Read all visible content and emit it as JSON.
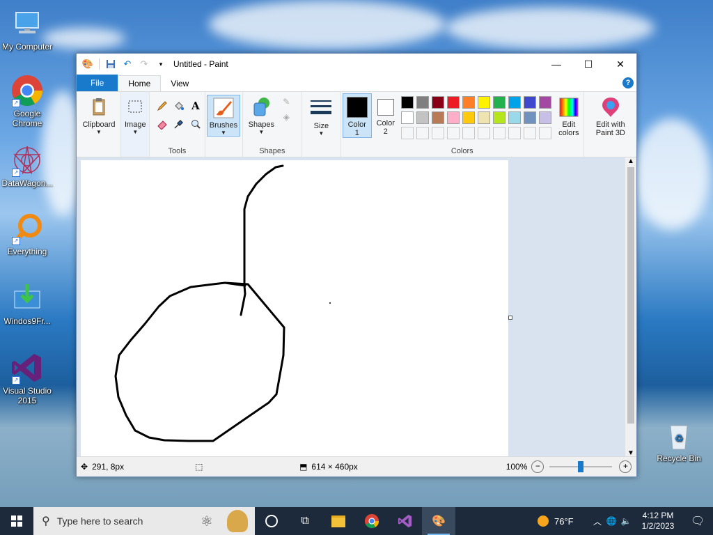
{
  "desktop": {
    "icons": [
      {
        "label": "My Computer"
      },
      {
        "label": "Google Chrome"
      },
      {
        "label": "DataWagon..."
      },
      {
        "label": "Everything"
      },
      {
        "label": "Windos9Fr..."
      },
      {
        "label": "Visual Studio 2015"
      },
      {
        "label": "Recycle Bin"
      }
    ]
  },
  "window": {
    "title": "Untitled - Paint",
    "tabs": [
      "File",
      "Home",
      "View"
    ],
    "help": "?"
  },
  "ribbon": {
    "clipboard": "Clipboard",
    "image": "Image",
    "tools": "Tools",
    "brushes": "Brushes",
    "shapes_btn": "Shapes",
    "shapes_group": "Shapes",
    "size": "Size",
    "color1": "Color\n1",
    "color1_a": "Color",
    "color1_b": "1",
    "color2_a": "Color",
    "color2_b": "2",
    "colors_group": "Colors",
    "edit_colors_a": "Edit",
    "edit_colors_b": "colors",
    "edit_paint3d_a": "Edit with",
    "edit_paint3d_b": "Paint 3D",
    "text_tool": "A",
    "palette_row1": [
      "#000000",
      "#7f7f7f",
      "#880015",
      "#ed1c24",
      "#ff7f27",
      "#fff200",
      "#22b14c",
      "#00a2e8",
      "#3f48cc",
      "#a349a4"
    ],
    "palette_row2": [
      "#ffffff",
      "#c3c3c3",
      "#b97a57",
      "#ffaec9",
      "#ffc90e",
      "#efe4b0",
      "#b5e61d",
      "#99d9ea",
      "#7092be",
      "#c8bfe7"
    ],
    "color1_value": "#000000",
    "color2_value": "#ffffff"
  },
  "status": {
    "cursor_pos": "291, 8px",
    "image_size": "614 × 460px",
    "zoom": "100%",
    "zoom_fraction": 0.5
  },
  "taskbar": {
    "search_placeholder": "Type here to search",
    "weather": "76°F",
    "time": "4:12 PM",
    "date": "1/2/2023"
  }
}
